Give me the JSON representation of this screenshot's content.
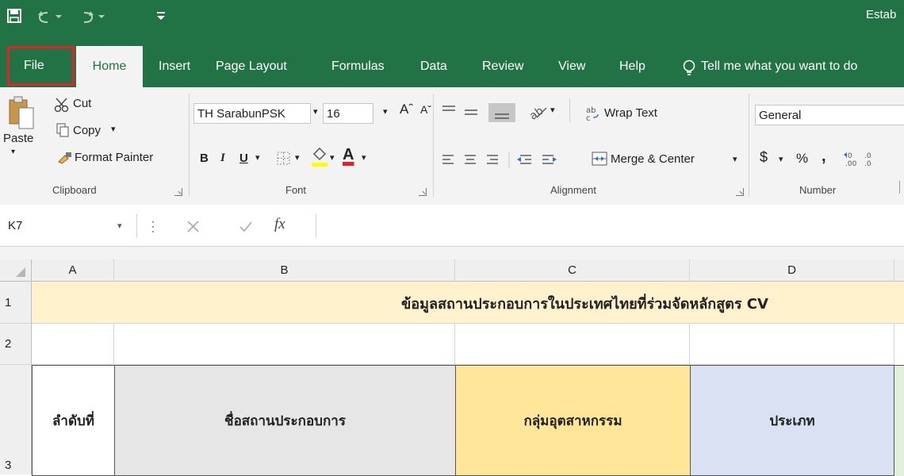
{
  "window": {
    "title_partial": "Estab"
  },
  "tabs": [
    {
      "label": "File"
    },
    {
      "label": "Home"
    },
    {
      "label": "Insert"
    },
    {
      "label": "Page Layout"
    },
    {
      "label": "Formulas"
    },
    {
      "label": "Data"
    },
    {
      "label": "Review"
    },
    {
      "label": "View"
    },
    {
      "label": "Help"
    }
  ],
  "tell_me": "Tell me what you want to do",
  "clipboard": {
    "paste": "Paste",
    "cut": "Cut",
    "copy": "Copy",
    "format_painter": "Format Painter",
    "group": "Clipboard"
  },
  "font": {
    "name": "TH SarabunPSK",
    "size": "16",
    "bold": "B",
    "italic": "I",
    "underline": "U",
    "font_color_glyph": "A",
    "group": "Font"
  },
  "alignment": {
    "wrap_text": "Wrap Text",
    "merge_center": "Merge & Center",
    "group": "Alignment"
  },
  "number": {
    "format": "General",
    "currency": "$",
    "percent": "%",
    "comma": ",",
    "group": "Number"
  },
  "formula_bar": {
    "name_box": "K7",
    "fx": "fx",
    "value": ""
  },
  "grid": {
    "columns": [
      "A",
      "B",
      "C",
      "D"
    ],
    "rows": [
      "1",
      "2",
      "3"
    ],
    "title_text": "ข้อมูลสถานประกอบการในประเทศไทยที่ร่วมจัดหลักสูตร CV",
    "headers": [
      "ลำดับที่",
      "ชื่อสถานประกอบการ",
      "กลุ่มอุตสาหกรรม",
      "ประเภท"
    ]
  },
  "colors": {
    "excel_green": "#217346",
    "highlight_red": "#e0222a",
    "title_row": "#fff2cc",
    "header_gray": "#e7e6e6",
    "header_yellow": "#ffe699",
    "header_blue": "#d9e1f2"
  }
}
